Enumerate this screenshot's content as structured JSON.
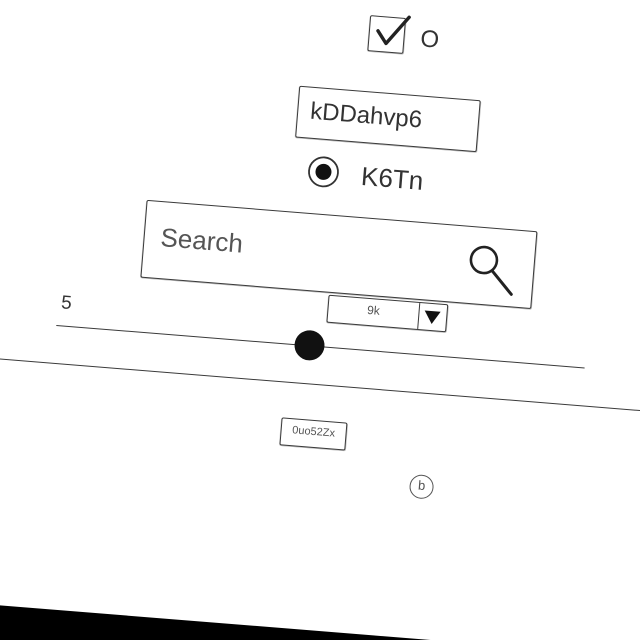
{
  "checkbox": {
    "label": "O",
    "checked": true,
    "icon": "check-icon"
  },
  "text_field": {
    "value": "kDDahvp6"
  },
  "radio": {
    "label": "K6Tn",
    "selected": true
  },
  "search": {
    "placeholder": "Search",
    "icon": "search-icon"
  },
  "slider": {
    "value": "5",
    "position": 0.48
  },
  "dropdown": {
    "value": "9k",
    "icon": "chevron-down-icon"
  },
  "small_box": {
    "value": "0uo52Zx"
  },
  "circle_badge": {
    "label": "b"
  }
}
